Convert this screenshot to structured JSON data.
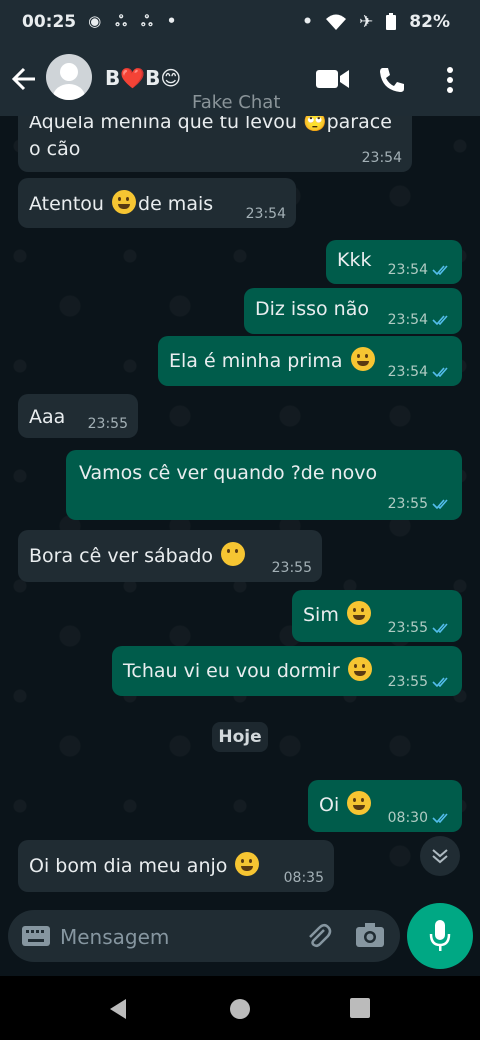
{
  "status_bar": {
    "time": "00:25",
    "battery": "82%"
  },
  "header": {
    "contact_name": "B❤️B😊",
    "watermark": "Fake Chat"
  },
  "messages": [
    {
      "text": "Aquela menina que tu levou 🙄parace",
      "text2": "o cão",
      "time": "23:54"
    },
    {
      "text": "Atentou",
      "text_after": "de mais",
      "time": "23:54"
    },
    {
      "text": "Kkk",
      "time": "23:54"
    },
    {
      "text": "Diz isso não",
      "time": "23:54"
    },
    {
      "text": "Ela é minha prima",
      "time": "23:54"
    },
    {
      "text": "Aaa",
      "time": "23:55"
    },
    {
      "text": "Vamos cê ver quando ?de novo",
      "time": "23:55"
    },
    {
      "text": "Bora cê ver sábado",
      "time": "23:55"
    },
    {
      "text": "Sim",
      "time": "23:55"
    },
    {
      "text": "Tchau vi eu vou dormir",
      "time": "23:55"
    },
    {
      "text": "Oi",
      "time": "08:30"
    },
    {
      "text": "Oi bom dia meu anjo",
      "time": "08:35"
    }
  ],
  "day_separator": "Hoje",
  "composer": {
    "placeholder": "Mensagem"
  },
  "colors": {
    "incoming": "#202c33",
    "outgoing": "#005c4b",
    "accent": "#00a884",
    "tick_read": "#53bdeb"
  }
}
